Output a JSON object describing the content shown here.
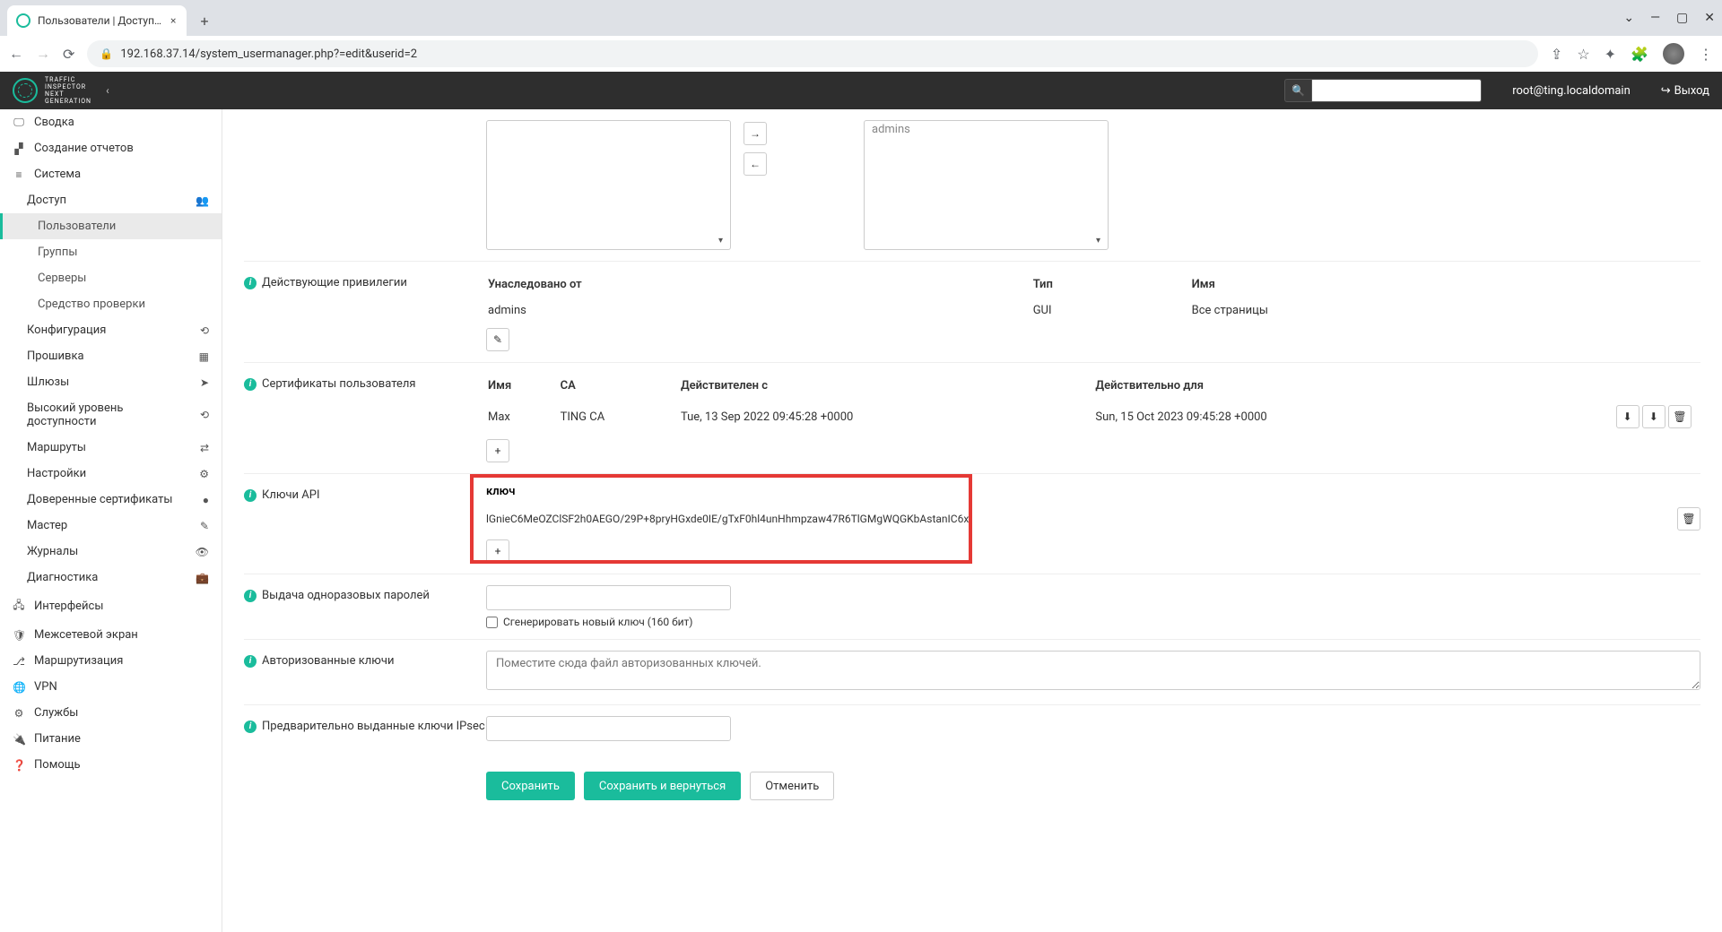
{
  "browser": {
    "tab_title": "Пользователи | Доступ | Систем",
    "url": "192.168.37.14/system_usermanager.php?=edit&userid=2"
  },
  "header": {
    "logo_text": "TRAFFIC\nINSPECTOR\nNEXT\nGENERATION",
    "search_placeholder": "",
    "user": "root@ting.localdomain",
    "logout": "Выход"
  },
  "sidebar": {
    "summary": "Сводка",
    "reports": "Создание отчетов",
    "system": "Система",
    "access": "Доступ",
    "users": "Пользователи",
    "groups": "Группы",
    "servers": "Серверы",
    "tester": "Средство проверки",
    "config": "Конфигурация",
    "firmware": "Прошивка",
    "gateways": "Шлюзы",
    "ha": "Высокий уровень доступности",
    "routes": "Маршруты",
    "settings": "Настройки",
    "trust": "Доверенные сертификаты",
    "wizard": "Мастер",
    "logs": "Журналы",
    "diag": "Диагностика",
    "interfaces": "Интерфейсы",
    "firewall": "Межсетевой экран",
    "routing": "Маршрутизация",
    "vpn": "VPN",
    "services": "Службы",
    "power": "Питание",
    "help": "Помощь"
  },
  "form": {
    "group_mem_label": "",
    "group_mem_value": "admins",
    "privs_label": "Действующие привилегии",
    "privs_head_inherit": "Унаследовано от",
    "privs_head_type": "Тип",
    "privs_head_name": "Имя",
    "privs_row_inherit": "admins",
    "privs_row_type": "GUI",
    "privs_row_name": "Все страницы",
    "certs_label": "Сертификаты пользователя",
    "certs_head_name": "Имя",
    "certs_head_ca": "CA",
    "certs_head_from": "Действителен с",
    "certs_head_to": "Действительно для",
    "certs_row_name": "Max",
    "certs_row_ca": "TING CA",
    "certs_row_from": "Tue, 13 Sep 2022 09:45:28 +0000",
    "certs_row_to": "Sun, 15 Oct 2023 09:45:28 +0000",
    "api_label": "Ключи API",
    "api_head_key": "ключ",
    "api_key_value": "lGnieC6MeOZClSF2h0AEGO/29P+8pryHGxde0IE/gTxF0hl4unHhmpzaw47R6TlGMgWQGKbAstanIC6x",
    "otp_label": "Выдача одноразовых паролей",
    "otp_checkbox": "Сгенерировать новый ключ (160 бит)",
    "auth_keys_label": "Авторизованные ключи",
    "auth_keys_placeholder": "Поместите сюда файл авторизованных ключей.",
    "ipsec_label": "Предварительно выданные ключи IPsec",
    "btn_save": "Сохранить",
    "btn_save_back": "Сохранить и вернуться",
    "btn_cancel": "Отменить"
  }
}
